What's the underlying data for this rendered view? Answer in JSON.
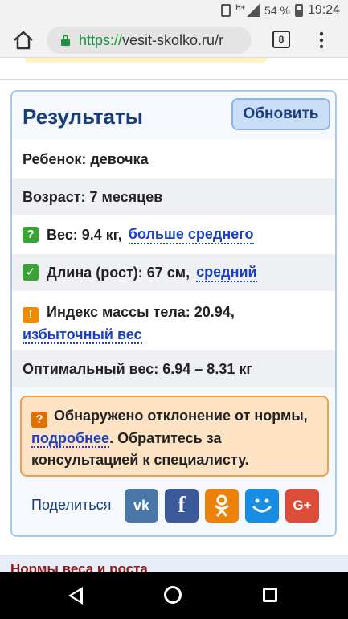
{
  "status_bar": {
    "network_type": "H+",
    "battery": "54 %",
    "time": "19:24"
  },
  "browser": {
    "url_scheme": "https://",
    "url_rest": "vesit-skolko.ru/r",
    "tabs_count": "8",
    "menu_icon": "⋮"
  },
  "results": {
    "title": "Результаты",
    "refresh_label": "Обновить",
    "child_row": "Ребенок: девочка",
    "age_row": "Возраст: 7 месяцев",
    "weight": {
      "badge": "?",
      "text": "Вес: 9.4 кг,",
      "link": "больше среднего"
    },
    "length": {
      "badge": "✓",
      "text": "Длина (рост): 67 см,",
      "link": "средний"
    },
    "bmi": {
      "badge": "!",
      "text": "Индекс массы тела: 20.94,",
      "link": "избыточный вес"
    },
    "optimal_row": "Оптимальный вес: 6.94 – 8.31 кг",
    "warning": {
      "badge": "?",
      "text_before": "Обнаружено отклонение от нормы,",
      "link": "подробнее",
      "text_after": ". Обратитесь за консультацией к специалисту."
    },
    "share": {
      "label": "Поделиться",
      "vk": "vk",
      "fb": "f",
      "ok": "ok",
      "mm": "☺",
      "gplus": "G+"
    }
  },
  "next_section_title": "Нормы веса и роста",
  "colors": {
    "title": "#1a3d7c",
    "link": "#1a3fc8",
    "card_border": "#a9c8ec",
    "warning_bg": "#fde3c4",
    "warning_border": "#f0a04a"
  }
}
